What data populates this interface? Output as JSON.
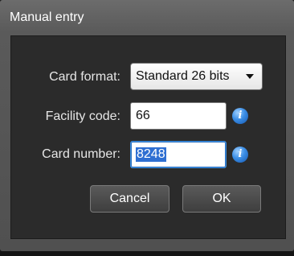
{
  "dialog": {
    "title": "Manual entry"
  },
  "form": {
    "card_format_label": "Card format:",
    "card_format_value": "Standard 26 bits",
    "facility_code_label": "Facility code:",
    "facility_code_value": "66",
    "card_number_label": "Card number:",
    "card_number_value": "8248",
    "info_icon_glyph": "i"
  },
  "buttons": {
    "cancel_label": "Cancel",
    "ok_label": "OK"
  },
  "icons": {
    "info": "info-icon",
    "dropdown": "chevron-down-icon"
  },
  "colors": {
    "accent": "#2f6fd2",
    "info_icon": "#3b8ee6"
  }
}
